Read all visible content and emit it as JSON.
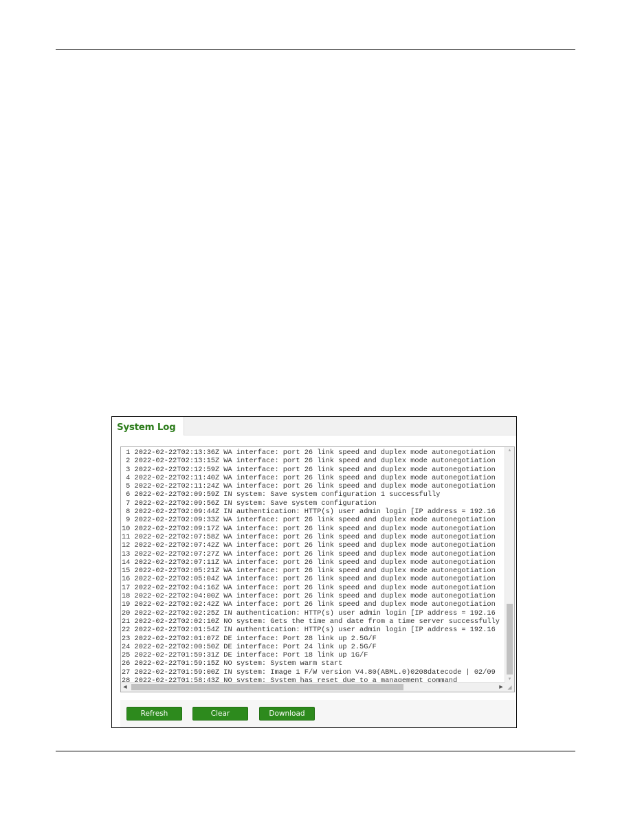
{
  "panel": {
    "tab_label": "System Log"
  },
  "log": {
    "lines": [
      " 1 2022-02-22T02:13:36Z WA interface: port 26 link speed and duplex mode autonegotiation",
      " 2 2022-02-22T02:13:15Z WA interface: port 26 link speed and duplex mode autonegotiation",
      " 3 2022-02-22T02:12:59Z WA interface: port 26 link speed and duplex mode autonegotiation",
      " 4 2022-02-22T02:11:40Z WA interface: port 26 link speed and duplex mode autonegotiation",
      " 5 2022-02-22T02:11:24Z WA interface: port 26 link speed and duplex mode autonegotiation",
      " 6 2022-02-22T02:09:59Z IN system: Save system configuration 1 successfully",
      " 7 2022-02-22T02:09:56Z IN system: Save system configuration",
      " 8 2022-02-22T02:09:44Z IN authentication: HTTP(s) user admin login [IP address = 192.16",
      " 9 2022-02-22T02:09:33Z WA interface: port 26 link speed and duplex mode autonegotiation",
      "10 2022-02-22T02:09:17Z WA interface: port 26 link speed and duplex mode autonegotiation",
      "11 2022-02-22T02:07:58Z WA interface: port 26 link speed and duplex mode autonegotiation",
      "12 2022-02-22T02:07:42Z WA interface: port 26 link speed and duplex mode autonegotiation",
      "13 2022-02-22T02:07:27Z WA interface: port 26 link speed and duplex mode autonegotiation",
      "14 2022-02-22T02:07:11Z WA interface: port 26 link speed and duplex mode autonegotiation",
      "15 2022-02-22T02:05:21Z WA interface: port 26 link speed and duplex mode autonegotiation",
      "16 2022-02-22T02:05:04Z WA interface: port 26 link speed and duplex mode autonegotiation",
      "17 2022-02-22T02:04:16Z WA interface: port 26 link speed and duplex mode autonegotiation",
      "18 2022-02-22T02:04:00Z WA interface: port 26 link speed and duplex mode autonegotiation",
      "19 2022-02-22T02:02:42Z WA interface: port 26 link speed and duplex mode autonegotiation",
      "20 2022-02-22T02:02:25Z IN authentication: HTTP(s) user admin login [IP address = 192.16",
      "21 2022-02-22T02:02:10Z NO system: Gets the time and date from a time server successfully",
      "22 2022-02-22T02:01:54Z IN authentication: HTTP(s) user admin login [IP address = 192.16",
      "23 2022-02-22T02:01:07Z DE interface: Port 28 link up 2.5G/F",
      "24 2022-02-22T02:00:50Z DE interface: Port 24 link up 2.5G/F",
      "25 2022-02-22T01:59:31Z DE interface: Port 18 link up 1G/F",
      "26 2022-02-22T01:59:15Z NO system: System warm start",
      "27 2022-02-22T01:59:00Z IN system: Image 1 F/W version V4.80(ABML.0)0208datecode | 02/09",
      "28 2022-02-22T01:58:43Z NO system: System has reset due to a management command"
    ]
  },
  "icons": {
    "scroll_up": "▲",
    "scroll_down": "▼",
    "scroll_left": "◀",
    "scroll_right": "▶",
    "resize_grip": "◢"
  },
  "buttons": {
    "refresh": "Refresh",
    "clear": "Clear",
    "download": "Download"
  },
  "colors": {
    "accent": "#2d8a1d",
    "tab_title": "#2e7d1d"
  }
}
